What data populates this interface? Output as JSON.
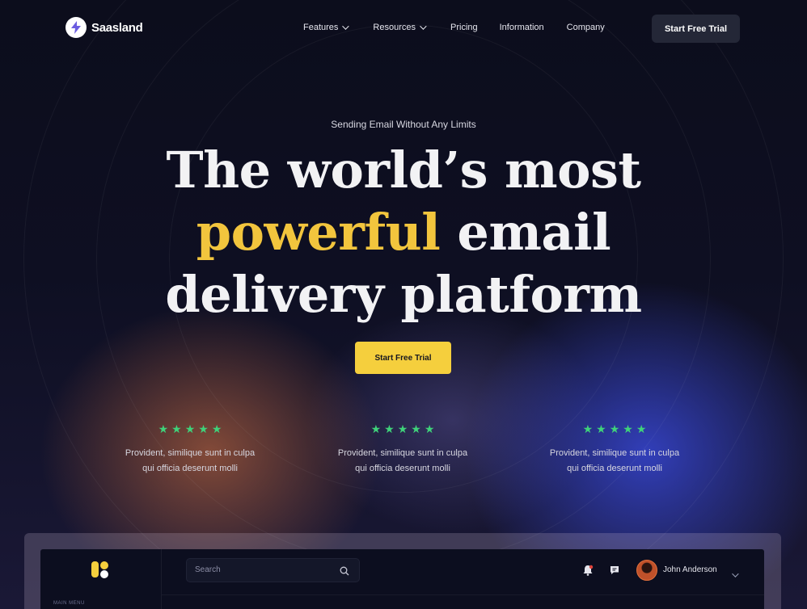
{
  "brand": {
    "name": "Saasland"
  },
  "nav": {
    "items": [
      {
        "label": "Features",
        "has_dropdown": true
      },
      {
        "label": "Resources",
        "has_dropdown": true
      },
      {
        "label": "Pricing",
        "has_dropdown": false
      },
      {
        "label": "Information",
        "has_dropdown": false
      },
      {
        "label": "Company",
        "has_dropdown": false
      }
    ],
    "cta_label": "Start Free Trial"
  },
  "hero": {
    "eyebrow": "Sending Email Without Any Limits",
    "headline_line1": "The world’s most",
    "headline_highlight": "powerful",
    "headline_line2_rest": "email",
    "headline_line3": "delivery platform",
    "cta_label": "Start Free Trial",
    "highlight_color": "#f2c53d",
    "cta_color": "#f5cf3d"
  },
  "reviews": [
    {
      "stars": 5,
      "line1": "Provident, similique sunt in culpa",
      "line2": "qui officia deserunt molli"
    },
    {
      "stars": 5,
      "line1": "Provident, similique sunt in culpa",
      "line2": "qui officia deserunt molli"
    },
    {
      "stars": 5,
      "line1": "Provident, similique sunt in culpa",
      "line2": "qui officia deserunt molli"
    }
  ],
  "star_color": "#3fd27a",
  "dashboard": {
    "search_placeholder": "Search",
    "user_name": "John Anderson",
    "sidebar_label": "MAIN MENU"
  },
  "icons": [
    "logo-bolt-icon",
    "chevron-down-icon",
    "star-icon",
    "search-icon",
    "bell-icon",
    "chat-icon",
    "app-logo-icon"
  ]
}
